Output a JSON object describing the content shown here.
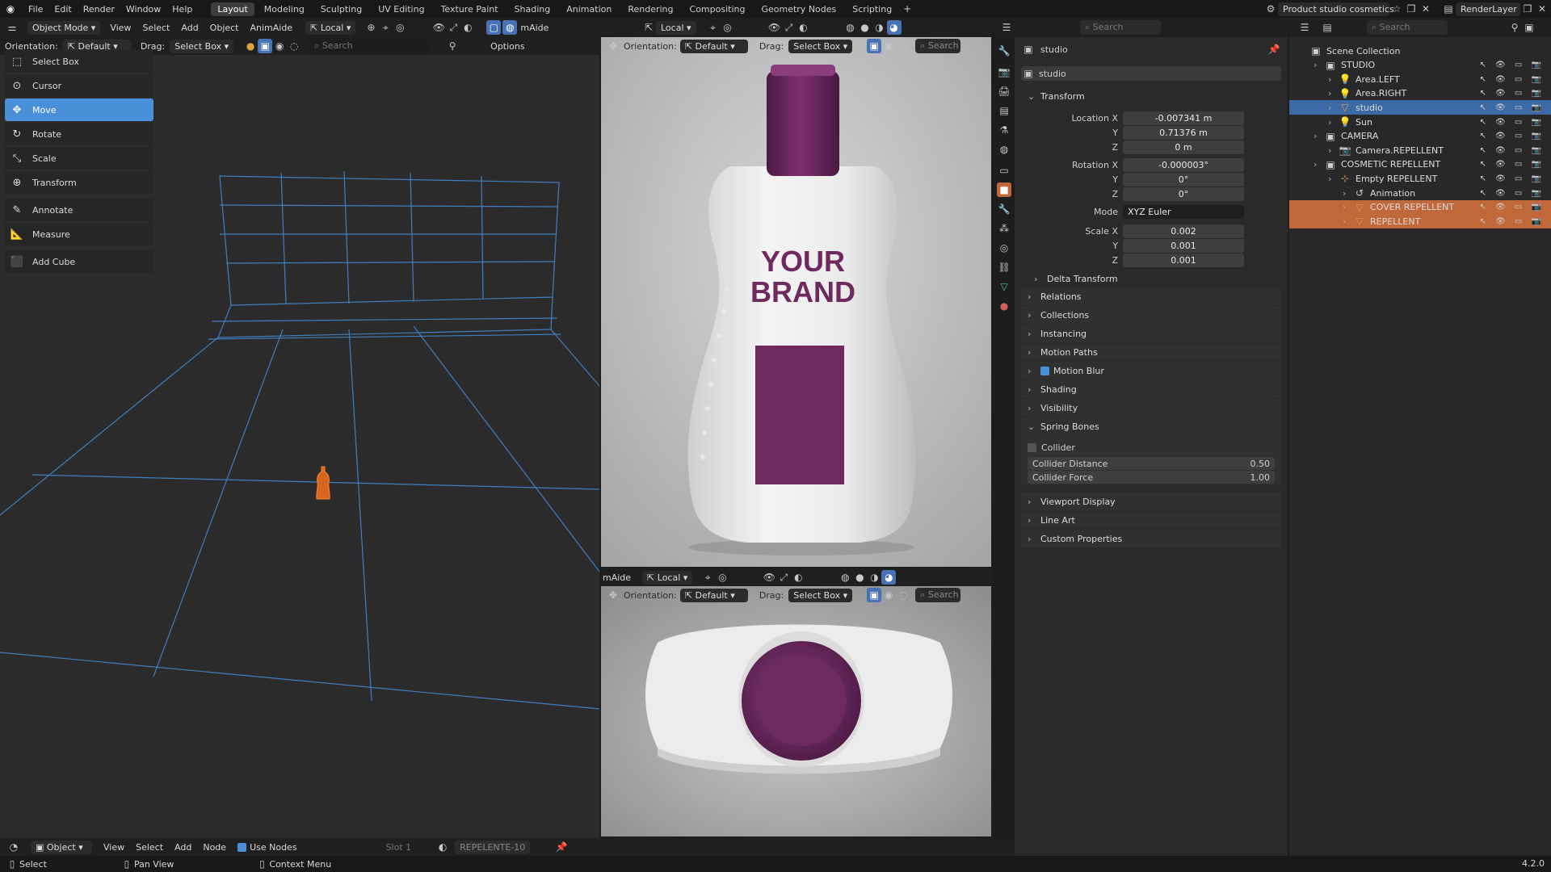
{
  "topbar": {
    "menus": [
      "File",
      "Edit",
      "Render",
      "Window",
      "Help"
    ],
    "workspaces": [
      "Layout",
      "Modeling",
      "Sculpting",
      "UV Editing",
      "Texture Paint",
      "Shading",
      "Animation",
      "Rendering",
      "Compositing",
      "Geometry Nodes",
      "Scripting"
    ],
    "active_workspace": "Layout",
    "scene_name": "Product studio cosmetics",
    "view_layer": "RenderLayer"
  },
  "left_header": {
    "mode": "Object Mode",
    "menus": [
      "View",
      "Select",
      "Add",
      "Object",
      "AnimAide"
    ],
    "transform_orientation": "Local",
    "orientation_label": "Orientation:",
    "orientation_value": "Default",
    "drag_label": "Drag:",
    "drag_value": "Select Box",
    "search_placeholder": "Search",
    "options": "Options"
  },
  "toolbar": {
    "tools": [
      "Select Box",
      "Cursor",
      "Move",
      "Rotate",
      "Scale",
      "Transform",
      "Annotate",
      "Measure",
      "Add Cube"
    ],
    "active_tool": "Move"
  },
  "render_viewports": {
    "header_label": "mAide",
    "orientation_label": "Orientation:",
    "orientation_value": "Default",
    "drag_label": "Drag:",
    "drag_value": "Select Box",
    "transform_orientation": "Local",
    "search_placeholder": "Search",
    "bottle_text_line1": "YOUR",
    "bottle_text_line2": "BRAND"
  },
  "properties": {
    "search_placeholder": "Search",
    "object_name": "studio",
    "datablock_name": "studio",
    "transform_title": "Transform",
    "location": {
      "label_x": "Location X",
      "x": "-0.007341 m",
      "y": "0.71376 m",
      "z": "0 m"
    },
    "rotation": {
      "label_x": "Rotation X",
      "x": "-0.000003°",
      "y": "0°",
      "z": "0°"
    },
    "mode_label": "Mode",
    "mode_value": "XYZ Euler",
    "scale": {
      "label_x": "Scale X",
      "x": "0.002",
      "y": "0.001",
      "z": "0.001"
    },
    "axis_y": "Y",
    "axis_z": "Z",
    "delta_transform": "Delta Transform",
    "sections": [
      "Relations",
      "Collections",
      "Instancing",
      "Motion Paths",
      "Motion Blur",
      "Shading",
      "Visibility"
    ],
    "spring_bones": "Spring Bones",
    "collider": "Collider",
    "collider_distance_label": "Collider Distance",
    "collider_distance": "0.50",
    "collider_force_label": "Collider Force",
    "collider_force": "1.00",
    "sections_after": [
      "Viewport Display",
      "Line Art",
      "Custom Properties"
    ]
  },
  "outliner": {
    "search_placeholder": "Search",
    "rows": [
      {
        "label": "Scene Collection",
        "indent": 0,
        "state": "normal"
      },
      {
        "label": "STUDIO",
        "indent": 1,
        "state": "normal"
      },
      {
        "label": "Area.LEFT",
        "indent": 2,
        "state": "normal"
      },
      {
        "label": "Area.RIGHT",
        "indent": 2,
        "state": "normal"
      },
      {
        "label": "studio",
        "indent": 2,
        "state": "selected"
      },
      {
        "label": "Sun",
        "indent": 2,
        "state": "normal"
      },
      {
        "label": "CAMERA",
        "indent": 1,
        "state": "normal"
      },
      {
        "label": "Camera.REPELLENT",
        "indent": 2,
        "state": "normal"
      },
      {
        "label": "COSMETIC REPELLENT",
        "indent": 1,
        "state": "normal"
      },
      {
        "label": "Empty REPELLENT",
        "indent": 2,
        "state": "normal"
      },
      {
        "label": "Animation",
        "indent": 3,
        "state": "normal"
      },
      {
        "label": "COVER REPELLENT",
        "indent": 3,
        "state": "highlight"
      },
      {
        "label": "REPELLENT",
        "indent": 3,
        "state": "highlight"
      }
    ]
  },
  "node_bar": {
    "editor_mode": "Object",
    "menus": [
      "View",
      "Select",
      "Add",
      "Node"
    ],
    "use_nodes": "Use Nodes",
    "slot": "Slot 1",
    "material": "REPELENTE-10"
  },
  "statusbar": {
    "select": "Select",
    "pan_view": "Pan View",
    "context_menu": "Context Menu",
    "version": "4.2.0"
  },
  "colors": {
    "accent": "#4a90d9",
    "selection": "#3b6aa6",
    "highlight_orange": "#c0683a",
    "bottle_purple": "#6e2a5e",
    "wire_blue": "#3f7fbf"
  }
}
